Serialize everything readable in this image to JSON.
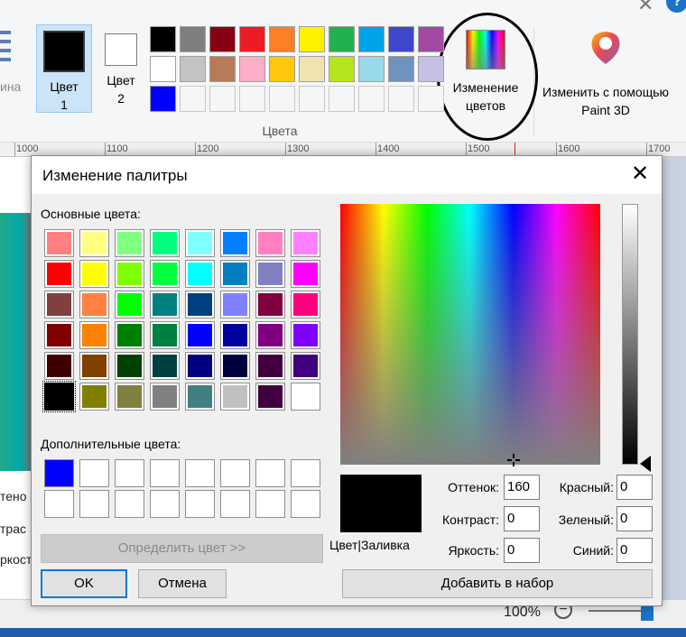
{
  "ribbon": {
    "left_cut_label": "ина",
    "color1_label": "Цвет 1",
    "color2_label": "Цвет 2",
    "colors_group_label": "Цвета",
    "edit_colors_label": "Изменение цветов",
    "paint3d_label": "Изменить с помощью Paint 3D",
    "palette_row1": [
      "#000000",
      "#7f7f7f",
      "#880015",
      "#ed1c24",
      "#ff7f27",
      "#fff200",
      "#22b14c",
      "#00a2e8",
      "#3f48cc",
      "#a349a4"
    ],
    "palette_row2": [
      "#ffffff",
      "#c3c3c3",
      "#b97a57",
      "#ffaec9",
      "#ffc90e",
      "#efe4b0",
      "#b5e61d",
      "#99d9ea",
      "#7092be",
      "#c8bfe7"
    ],
    "palette_row3": [
      "#0000ff",
      "",
      "",
      "",
      "",
      "",
      "",
      "",
      "",
      ""
    ]
  },
  "ruler": {
    "labels": [
      "1000",
      "1100",
      "1200",
      "1300",
      "1400",
      "1500",
      "1600",
      "1700"
    ]
  },
  "left_cut": {
    "hue": "тено",
    "sat": "трас",
    "lum": "ркост"
  },
  "status": {
    "zoom": "100%",
    "zoom_minus": "−"
  },
  "dialog": {
    "title": "Изменение палитры",
    "close": "✕",
    "basic_label": "Основные цвета:",
    "custom_label": "Дополнительные цвета:",
    "basic_colors": [
      [
        "#ff8080",
        "#ffff80",
        "#80ff80",
        "#00ff80",
        "#80ffff",
        "#0080ff",
        "#ff80c0",
        "#ff80ff"
      ],
      [
        "#ff0000",
        "#ffff00",
        "#80ff00",
        "#00ff40",
        "#00ffff",
        "#0080c0",
        "#8080c0",
        "#ff00ff"
      ],
      [
        "#804040",
        "#ff8040",
        "#00ff00",
        "#008080",
        "#004080",
        "#8080ff",
        "#800040",
        "#ff0080"
      ],
      [
        "#800000",
        "#ff8000",
        "#008000",
        "#008040",
        "#0000ff",
        "#0000a0",
        "#800080",
        "#8000ff"
      ],
      [
        "#400000",
        "#804000",
        "#004000",
        "#004040",
        "#000080",
        "#000040",
        "#400040",
        "#400080"
      ],
      [
        "#000000",
        "#808000",
        "#808040",
        "#808080",
        "#408080",
        "#c0c0c0",
        "#400040",
        "#ffffff"
      ]
    ],
    "custom_colors": [
      [
        "#0000ff",
        "#ffffff",
        "#ffffff",
        "#ffffff",
        "#ffffff",
        "#ffffff",
        "#ffffff",
        "#ffffff"
      ],
      [
        "#ffffff",
        "#ffffff",
        "#ffffff",
        "#ffffff",
        "#ffffff",
        "#ffffff",
        "#ffffff",
        "#ffffff"
      ]
    ],
    "define_button": "Определить цвет >>",
    "ok_button": "OK",
    "cancel_button": "Отмена",
    "add_button": "Добавить в набор",
    "preview_label": "Цвет|Заливка",
    "preview_color": "#000000",
    "hue_label": "Оттенок:",
    "hue_value": "160",
    "sat_label": "Контраст:",
    "sat_value": "0",
    "lum_label": "Яркость:",
    "lum_value": "0",
    "red_label": "Красный:",
    "red_value": "0",
    "green_label": "Зеленый:",
    "green_value": "0",
    "blue_label": "Синий:",
    "blue_value": "0"
  }
}
